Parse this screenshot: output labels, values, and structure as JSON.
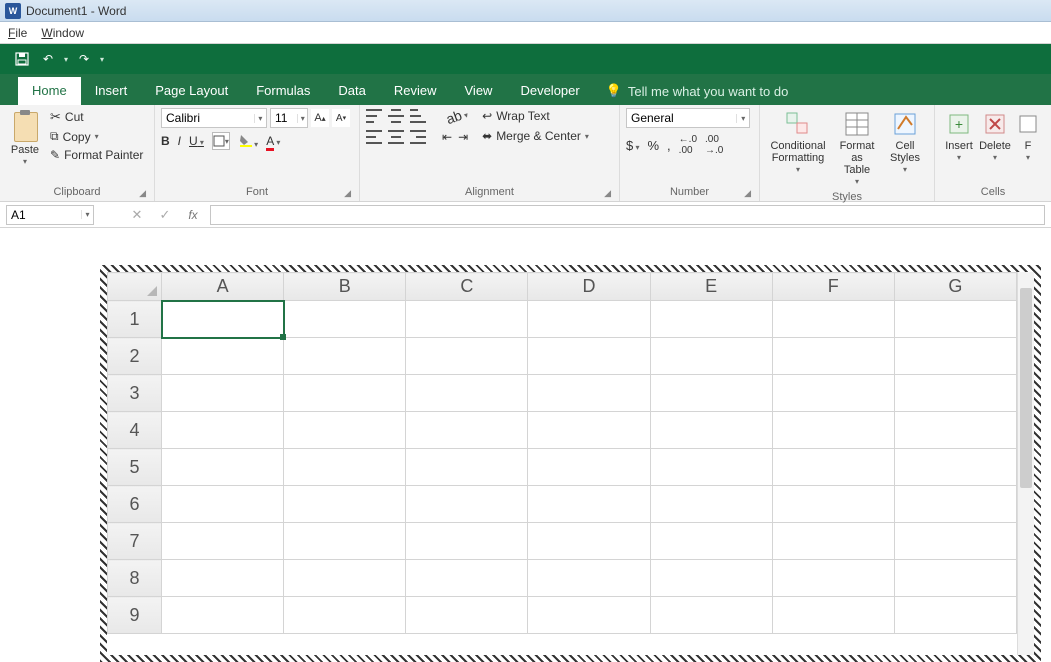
{
  "titlebar": {
    "title": "Document1 - Word",
    "appicon": "W"
  },
  "menubar": {
    "file": "File",
    "window": "Window"
  },
  "tabs": {
    "items": [
      "Home",
      "Insert",
      "Page Layout",
      "Formulas",
      "Data",
      "Review",
      "View",
      "Developer"
    ],
    "active": "Home",
    "tell_me": "Tell me what you want to do"
  },
  "clipboard": {
    "paste": "Paste",
    "cut": "Cut",
    "copy": "Copy",
    "format_painter": "Format Painter",
    "label": "Clipboard"
  },
  "font": {
    "name": "Calibri",
    "size": "11",
    "bold": "B",
    "italic": "I",
    "underline": "U",
    "label": "Font"
  },
  "alignment": {
    "wrap": "Wrap Text",
    "merge": "Merge & Center",
    "label": "Alignment"
  },
  "number": {
    "format": "General",
    "currency": "$",
    "percent": "%",
    "comma": ",",
    "inc": ".00→.0",
    "dec": ".0→.00",
    "label": "Number"
  },
  "styles": {
    "conditional": "Conditional Formatting",
    "table": "Format as Table",
    "cell": "Cell Styles",
    "label": "Styles"
  },
  "cells": {
    "insert": "Insert",
    "delete": "Delete",
    "format": "Format",
    "label": "Cells"
  },
  "formula_bar": {
    "name": "A1",
    "fx": "fx"
  },
  "sheet": {
    "columns": [
      "A",
      "B",
      "C",
      "D",
      "E",
      "F",
      "G"
    ],
    "rows": [
      "1",
      "2",
      "3",
      "4",
      "5",
      "6",
      "7",
      "8",
      "9"
    ],
    "selected": "A1"
  }
}
